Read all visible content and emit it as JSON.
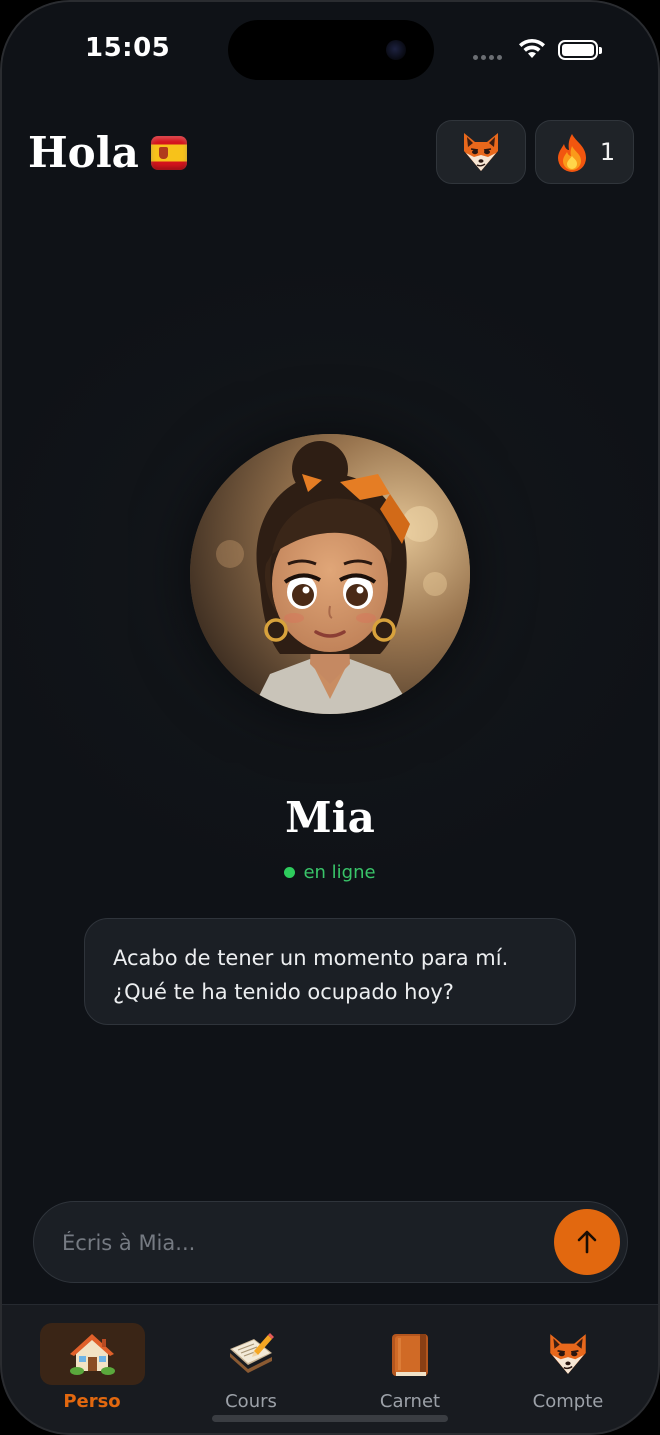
{
  "status_bar": {
    "time": "15:05",
    "icons": [
      "signal-icon",
      "wifi-icon",
      "battery-icon"
    ]
  },
  "header": {
    "title": "Hola",
    "flag": "spain-flag-icon",
    "profile_icon": "fox-icon",
    "streak_icon": "flame-icon",
    "streak_count": "1"
  },
  "character": {
    "name": "Mia",
    "status": "en ligne",
    "status_color": "#2ecc5d"
  },
  "message": {
    "text": "Acabo de tener un momento para mí. ¿Qué te ha tenido ocupado hoy?"
  },
  "composer": {
    "value": "",
    "placeholder": "Écris à Mia...",
    "send_icon": "arrow-up-icon"
  },
  "tabs": [
    {
      "label": "Perso",
      "icon": "house-icon",
      "active": true
    },
    {
      "label": "Cours",
      "icon": "notebook-pencil-icon",
      "active": false
    },
    {
      "label": "Carnet",
      "icon": "book-icon",
      "active": false
    },
    {
      "label": "Compte",
      "icon": "fox-icon",
      "active": false
    }
  ],
  "colors": {
    "accent": "#e2680f",
    "background": "#111418",
    "surface": "#1b1f25",
    "online": "#2ecc5d"
  }
}
